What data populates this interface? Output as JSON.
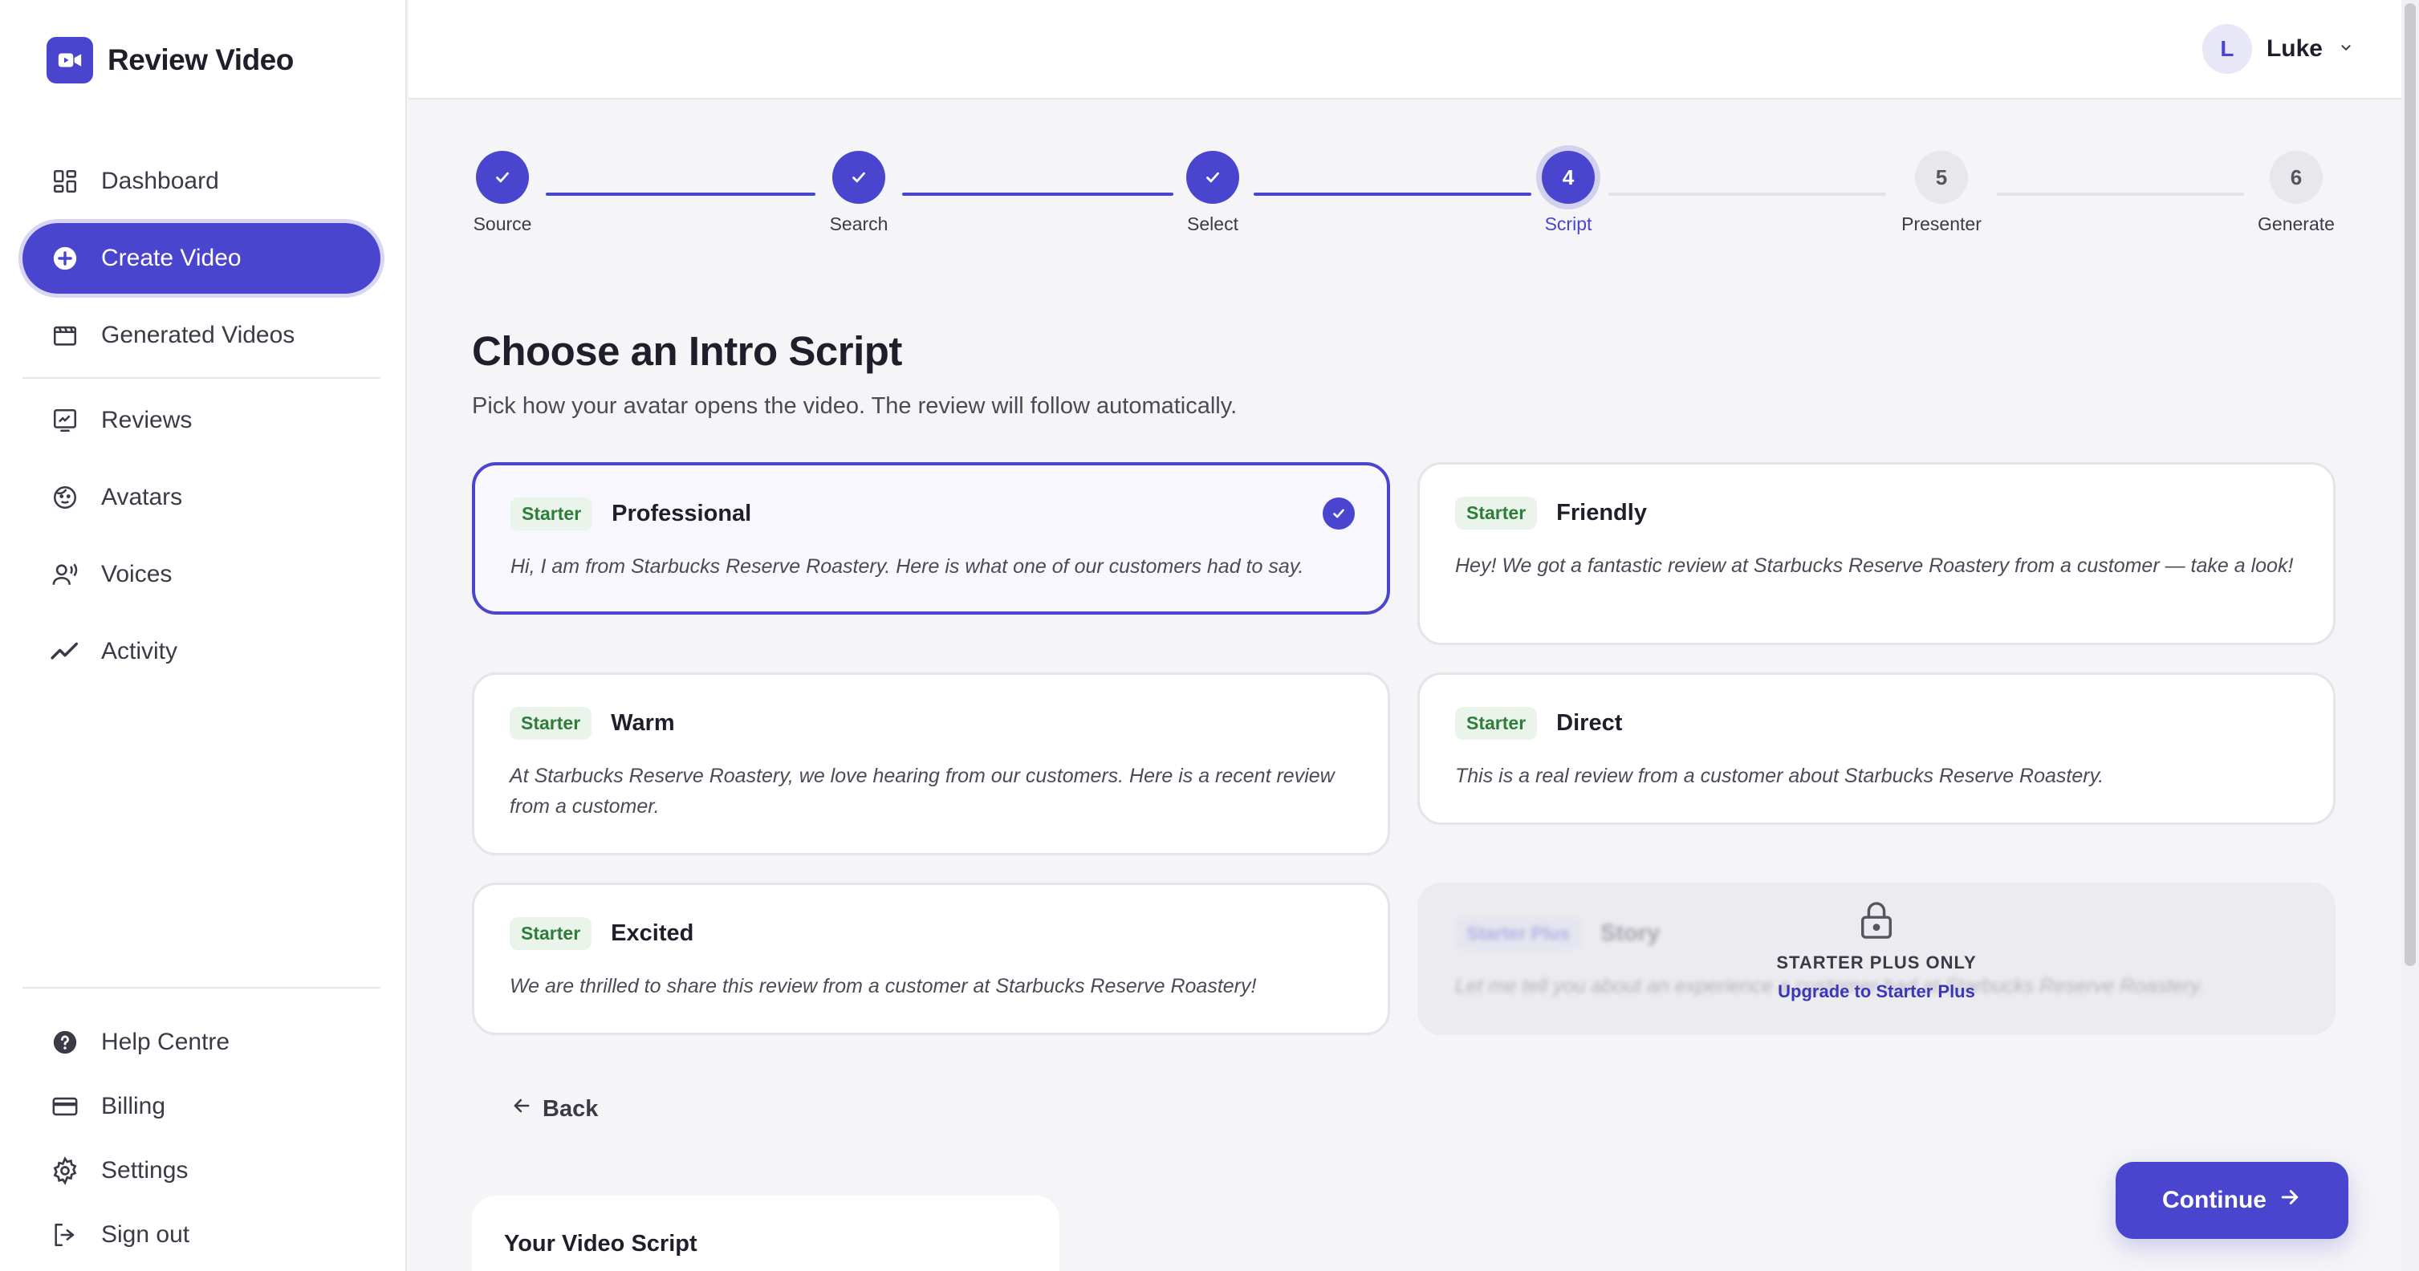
{
  "brand": {
    "name": "Review Video",
    "accent": "#4a45cf"
  },
  "sidebar": {
    "items": [
      {
        "label": "Dashboard",
        "icon": "dashboard-icon"
      },
      {
        "label": "Create Video",
        "icon": "plus-circle-icon",
        "active": true
      },
      {
        "label": "Generated Videos",
        "icon": "film-icon"
      },
      {
        "label": "Reviews",
        "icon": "reviews-icon"
      },
      {
        "label": "Avatars",
        "icon": "face-icon"
      },
      {
        "label": "Voices",
        "icon": "voice-icon"
      },
      {
        "label": "Activity",
        "icon": "activity-icon"
      }
    ],
    "footer": [
      {
        "label": "Help Centre",
        "icon": "help-icon"
      },
      {
        "label": "Billing",
        "icon": "credit-card-icon"
      },
      {
        "label": "Settings",
        "icon": "gear-icon"
      },
      {
        "label": "Sign out",
        "icon": "sign-out-icon"
      }
    ]
  },
  "user": {
    "initial": "L",
    "name": "Luke"
  },
  "stepper": {
    "steps": [
      {
        "label": "Source",
        "status": "done"
      },
      {
        "label": "Search",
        "status": "done"
      },
      {
        "label": "Select",
        "status": "done"
      },
      {
        "label": "Script",
        "number": "4",
        "status": "current"
      },
      {
        "label": "Presenter",
        "number": "5",
        "status": "todo"
      },
      {
        "label": "Generate",
        "number": "6",
        "status": "todo"
      }
    ]
  },
  "main": {
    "title": "Choose an Intro Script",
    "subtitle": "Pick how your avatar opens the video. The review will follow automatically."
  },
  "scripts": [
    {
      "badge": "Starter",
      "title": "Professional",
      "text": "Hi, I am from Starbucks Reserve Roastery. Here is what one of our customers had to say.",
      "selected": true
    },
    {
      "badge": "Starter",
      "title": "Friendly",
      "text": "Hey! We got a fantastic review at Starbucks Reserve Roastery from a customer — take a look!"
    },
    {
      "badge": "Starter",
      "title": "Warm",
      "text": "At Starbucks Reserve Roastery, we love hearing from our customers. Here is a recent review from a customer."
    },
    {
      "badge": "Starter",
      "title": "Direct",
      "text": "This is a real review from a customer about Starbucks Reserve Roastery."
    },
    {
      "badge": "Starter",
      "title": "Excited",
      "text": "We are thrilled to share this review from a customer at Starbucks Reserve Roastery!"
    },
    {
      "badge": "Starter Plus",
      "title": "Story",
      "text": "Let me tell you about an experience a customer had at Starbucks Reserve Roastery.",
      "locked": true
    }
  ],
  "locked": {
    "title": "STARTER PLUS ONLY",
    "link": "Upgrade to Starter Plus"
  },
  "actions": {
    "back": "Back",
    "continue": "Continue"
  },
  "script_panel": {
    "title": "Your Video Script"
  }
}
